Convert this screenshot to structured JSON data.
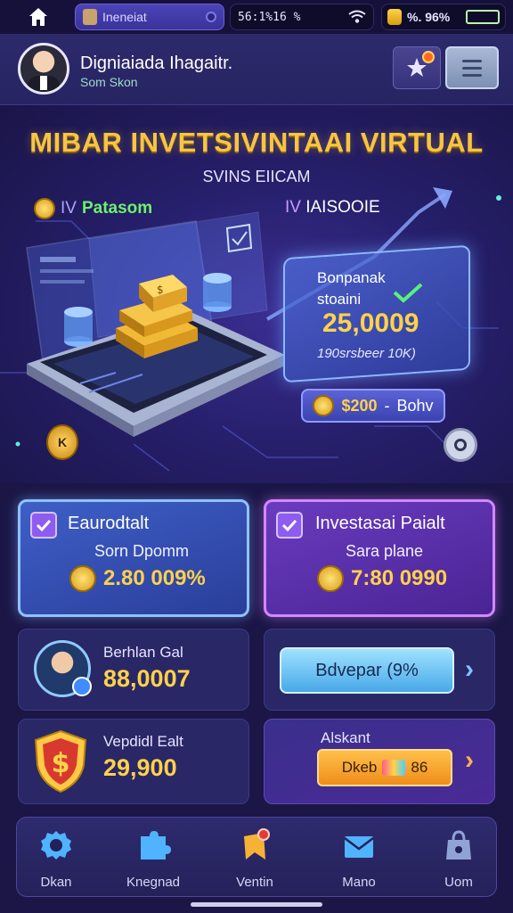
{
  "status_bar": {
    "tab_label": "Ineneiat",
    "time_text": "56:1%16 %",
    "right_text": "%. 96%",
    "battery_level": 0.85
  },
  "header": {
    "user_name": "Digniaiada Ihagaitr.",
    "user_sub": "Som Skon"
  },
  "hero": {
    "title": "MIBAR INVETSIVINTAAI VIRTUAL",
    "subtitle": "SVINS EIICAM",
    "tag_left_prefix": "IV",
    "tag_left": "Patasom",
    "tag_right_prefix": "IV",
    "tag_right": "IAISOOIE",
    "stat_line1": "Bonpanak",
    "stat_line2": "stoaini",
    "stat_value": "25,0009",
    "stat_footer": "190srsbeer 10K)",
    "reward_amount": "$200",
    "reward_sep": "-",
    "reward_label": "Bohv",
    "tag_icon_text": "K"
  },
  "cards": {
    "a": {
      "title": "Eaurodtalt",
      "sub": "Sorn Dpomm",
      "value": "2.80 009%"
    },
    "b": {
      "title": "Investasai Paialt",
      "sub": "Sara plane",
      "value": "7:80 0990"
    },
    "c": {
      "title": "Berhlan Gal",
      "value": "88,0007"
    },
    "d": {
      "button_label": "Bdvepar (9%"
    },
    "e": {
      "title": "Vepdidl Ealt",
      "value": "29,900"
    },
    "f": {
      "title": "Alskant",
      "button_label": "Dkeb",
      "button_suffix": "86"
    }
  },
  "nav": [
    {
      "label": "Dkan",
      "icon": "gear-icon"
    },
    {
      "label": "Knegnad",
      "icon": "puzzle-icon"
    },
    {
      "label": "Ventin",
      "icon": "bookmark-icon"
    },
    {
      "label": "Mano",
      "icon": "envelope-icon"
    },
    {
      "label": "Uom",
      "icon": "bag-icon"
    }
  ],
  "colors": {
    "background": "#1b1646",
    "accent_gold": "#ffd24a",
    "accent_blue": "#8fc2ff",
    "accent_purple": "#d487ff"
  }
}
